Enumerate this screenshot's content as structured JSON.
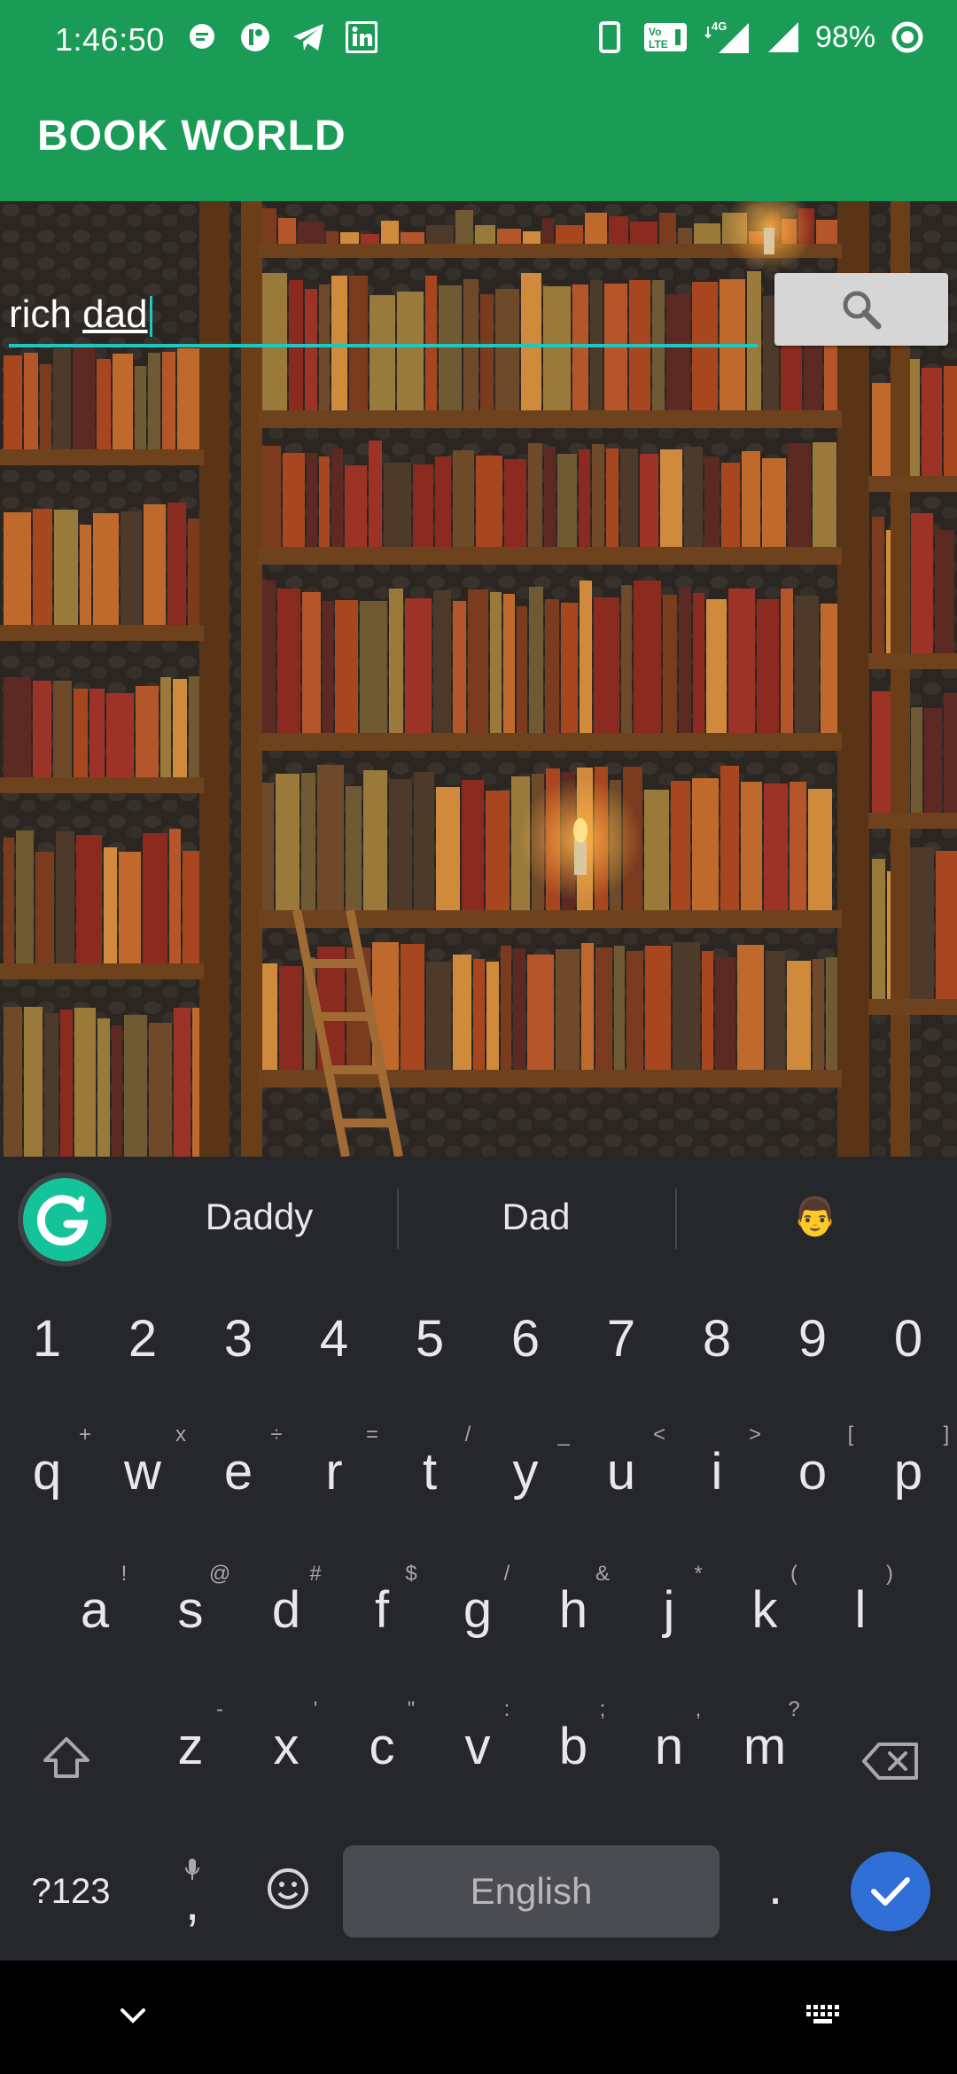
{
  "status_bar": {
    "time": "1:46:50",
    "battery": "98%",
    "icons": [
      "message-icon",
      "badge-icon",
      "telegram-icon",
      "linkedin-icon",
      "phone-icon",
      "volte-icon",
      "signal-4g-icon",
      "signal-icon",
      "battery-ring-icon"
    ]
  },
  "app_bar": {
    "title": "BOOK WORLD"
  },
  "search": {
    "value_plain": "rich ",
    "value_underlined": "dad",
    "button_icon": "search-icon"
  },
  "keyboard": {
    "suggestions": [
      "Daddy",
      "Dad",
      "👨"
    ],
    "numbers": [
      "1",
      "2",
      "3",
      "4",
      "5",
      "6",
      "7",
      "8",
      "9",
      "0"
    ],
    "row1": [
      "q",
      "w",
      "e",
      "r",
      "t",
      "y",
      "u",
      "i",
      "o",
      "p"
    ],
    "row1_hints": [
      "+",
      "x",
      "÷",
      "=",
      "/",
      "_",
      "<",
      ">",
      "[",
      "]"
    ],
    "row2": [
      "a",
      "s",
      "d",
      "f",
      "g",
      "h",
      "j",
      "k",
      "l"
    ],
    "row2_hints": [
      "!",
      "@",
      "#",
      "$",
      "/",
      "&",
      "*",
      "(",
      ")"
    ],
    "row3": [
      "z",
      "x",
      "c",
      "v",
      "b",
      "n",
      "m"
    ],
    "row3_hints": [
      "-",
      "'",
      "\"",
      ":",
      ";",
      ",",
      "?"
    ],
    "symbols_label": "?123",
    "comma_label": ",",
    "space_label": "English",
    "period_label": "."
  },
  "colors": {
    "brand_green": "#1a9c56",
    "accent_teal": "#1ec8c0",
    "keyboard_bg": "#25272b",
    "enter_blue": "#2f6fd6"
  }
}
